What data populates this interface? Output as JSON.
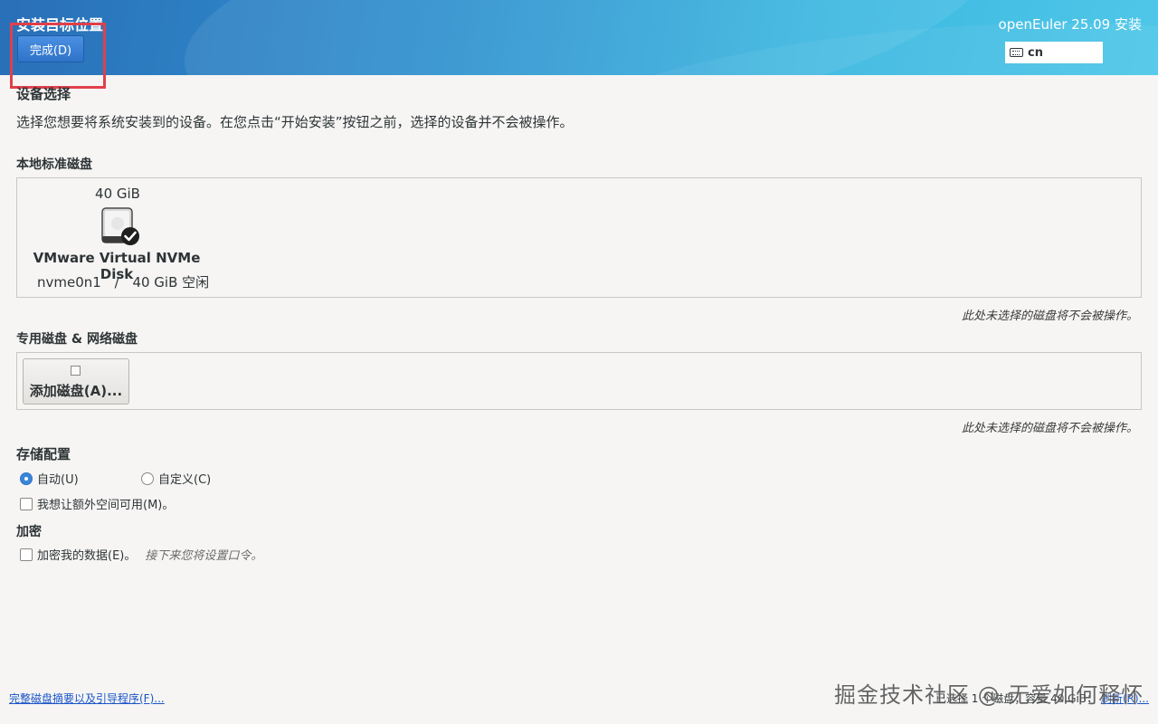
{
  "header": {
    "spoke_title": "安装目标位置",
    "done_button": "完成(D)",
    "product_title": "openEuler 25.09 安装",
    "keyboard_layout": "cn"
  },
  "device_selection": {
    "heading": "设备选择",
    "intro": "选择您想要将系统安装到的设备。在您点击“开始安装”按钮之前，选择的设备并不会被操作。"
  },
  "local_disks": {
    "heading": "本地标准磁盘",
    "disks": [
      {
        "size": "40 GiB",
        "name": "VMware Virtual NVMe Disk",
        "device": "nvme0n1",
        "separator": "/",
        "free": "40 GiB 空闲",
        "selected": true,
        "icon": "hard-disk-icon"
      }
    ],
    "note": "此处未选择的磁盘将不会被操作。"
  },
  "specialized_disks": {
    "heading": "专用磁盘 & 网络磁盘",
    "add_button": "添加磁盘(A)...",
    "note": "此处未选择的磁盘将不会被操作。"
  },
  "storage_config": {
    "heading": "存储配置",
    "auto_label": "自动(U)",
    "custom_label": "自定义(C)",
    "selected": "auto",
    "extra_space_label": "我想让额外空间可用(M)。"
  },
  "encryption": {
    "heading": "加密",
    "encrypt_label": "加密我的数据(E)。",
    "hint": "接下来您将设置口令。"
  },
  "footer": {
    "summary_link": "完整磁盘摘要以及引导程序(F)...",
    "status_text": "已选择 1 个磁盘；容量 40 GiB；",
    "refresh_link": "刷新(R)..."
  },
  "watermark": "掘金技术社区 @ 无爱如何释怀",
  "colors": {
    "accent": "#3a86d8",
    "link": "#1a55c8",
    "highlight": "#e0404a"
  }
}
